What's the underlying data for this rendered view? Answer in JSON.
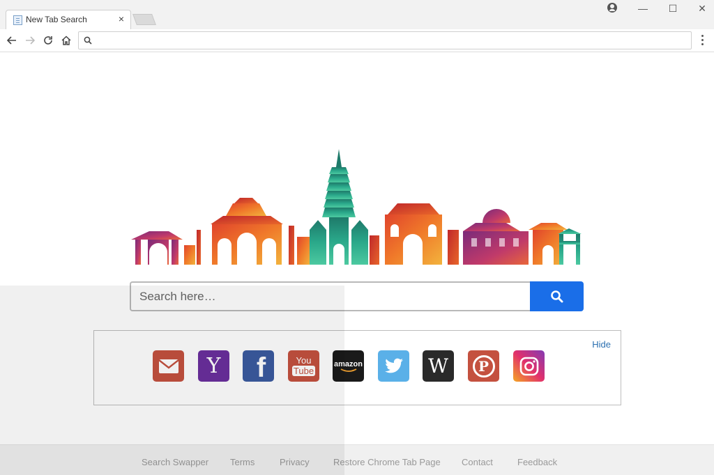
{
  "browser": {
    "tab_title": "New Tab Search",
    "tab_close": "×",
    "window_minimize": "—",
    "window_maximize": "☐",
    "window_close": "✕",
    "omnibox_value": "",
    "icons": [
      "back-arrow-icon",
      "forward-arrow-icon",
      "reload-icon",
      "home-icon",
      "search-icon",
      "menu-dots-icon",
      "profile-icon"
    ]
  },
  "search": {
    "placeholder": "Search here…",
    "button_icon": "search-icon",
    "button_color": "#1a6ee8"
  },
  "quick_links": {
    "hide_label": "Hide",
    "items": [
      {
        "name": "gmail",
        "icon": "mail-icon",
        "color": "#c4513f",
        "glyph": "✉"
      },
      {
        "name": "yahoo",
        "icon": "yahoo-icon",
        "color": "#6b2f9e",
        "glyph": "Y"
      },
      {
        "name": "facebook",
        "icon": "facebook-icon",
        "color": "#3b5ba0",
        "glyph": "f"
      },
      {
        "name": "youtube",
        "icon": "youtube-icon",
        "color": "#c4513f",
        "glyph_top": "You",
        "glyph_bottom": "Tube"
      },
      {
        "name": "amazon",
        "icon": "amazon-icon",
        "color": "#1a1a1a",
        "glyph": "amazon"
      },
      {
        "name": "twitter",
        "icon": "twitter-icon",
        "color": "#5ab0e8",
        "glyph": "🐦"
      },
      {
        "name": "wikipedia",
        "icon": "wikipedia-icon",
        "color": "#2a2a2a",
        "glyph": "W"
      },
      {
        "name": "pinterest",
        "icon": "pinterest-icon",
        "color": "#c4513f",
        "glyph": "P"
      },
      {
        "name": "instagram",
        "icon": "instagram-icon",
        "color": "#c13584",
        "glyph": ""
      }
    ]
  },
  "footer": {
    "links": [
      "Search Swapper",
      "Terms",
      "Privacy",
      "Restore Chrome Tab Page",
      "Contact",
      "Feedback"
    ]
  },
  "colors": {
    "link_blue": "#2a6fb0",
    "footer_text": "#999999"
  }
}
